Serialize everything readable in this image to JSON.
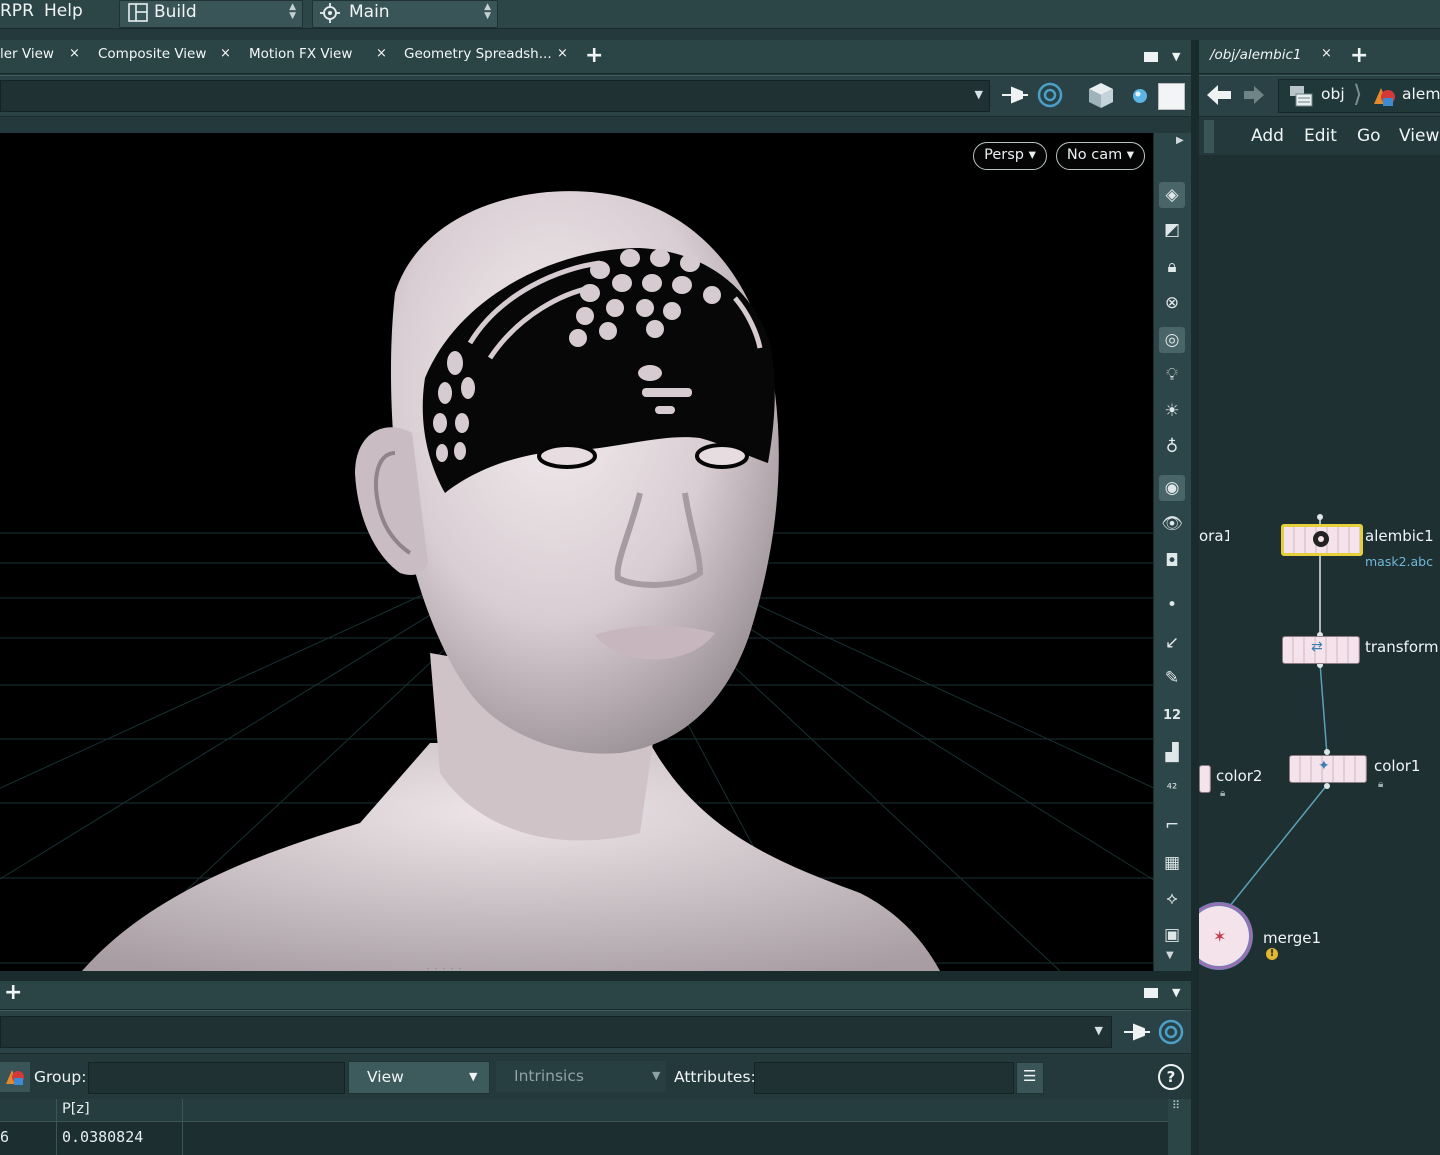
{
  "menubar": {
    "items": [
      "RPR",
      "Help"
    ],
    "desktop_label": "Build",
    "context_label": "Main"
  },
  "viewer_tabs": [
    {
      "label": "ler View"
    },
    {
      "label": "Composite View"
    },
    {
      "label": "Motion FX View"
    },
    {
      "label": "Geometry Spreadsh..."
    }
  ],
  "network_tab": {
    "label": "/obj/alembic1"
  },
  "network_path": {
    "root": "obj",
    "node": "alem"
  },
  "network_menu": [
    "Add",
    "Edit",
    "Go",
    "View"
  ],
  "viewport": {
    "camera_mode": "Persp",
    "camera": "No cam"
  },
  "nodes": {
    "alembic1": {
      "name": "alembic1",
      "file": "mask2.abc"
    },
    "transform": {
      "name": "transform1"
    },
    "color1": {
      "name": "color1"
    },
    "color2": {
      "name": "color2"
    },
    "merge1": {
      "name": "merge1"
    },
    "partial": {
      "name": "ora1"
    }
  },
  "spreadsheet": {
    "group_label": "Group:",
    "group_value": "",
    "view_label": "View",
    "intrinsics_label": "Intrinsics",
    "attributes_label": "Attributes:",
    "attributes_value": "",
    "columns": [
      "P[z]"
    ],
    "rows": [
      {
        "index": "6",
        "values": [
          "0.0380824"
        ]
      }
    ]
  },
  "colors": {
    "panel_bg": "#23393b",
    "viewport_bg": "#000000",
    "selected_node_border": "#e5cf3d",
    "wire": "#5aa2b8",
    "node_body": "#f4e3ea",
    "file_label": "#6fb7d9"
  },
  "icons": [
    "desktop-icon",
    "network-context-icon",
    "pin-icon",
    "target-icon",
    "cube-icon",
    "sphere-icon",
    "back-arrow-icon",
    "forward-arrow-icon",
    "help-icon",
    "warning-icon",
    "lock-icon"
  ]
}
